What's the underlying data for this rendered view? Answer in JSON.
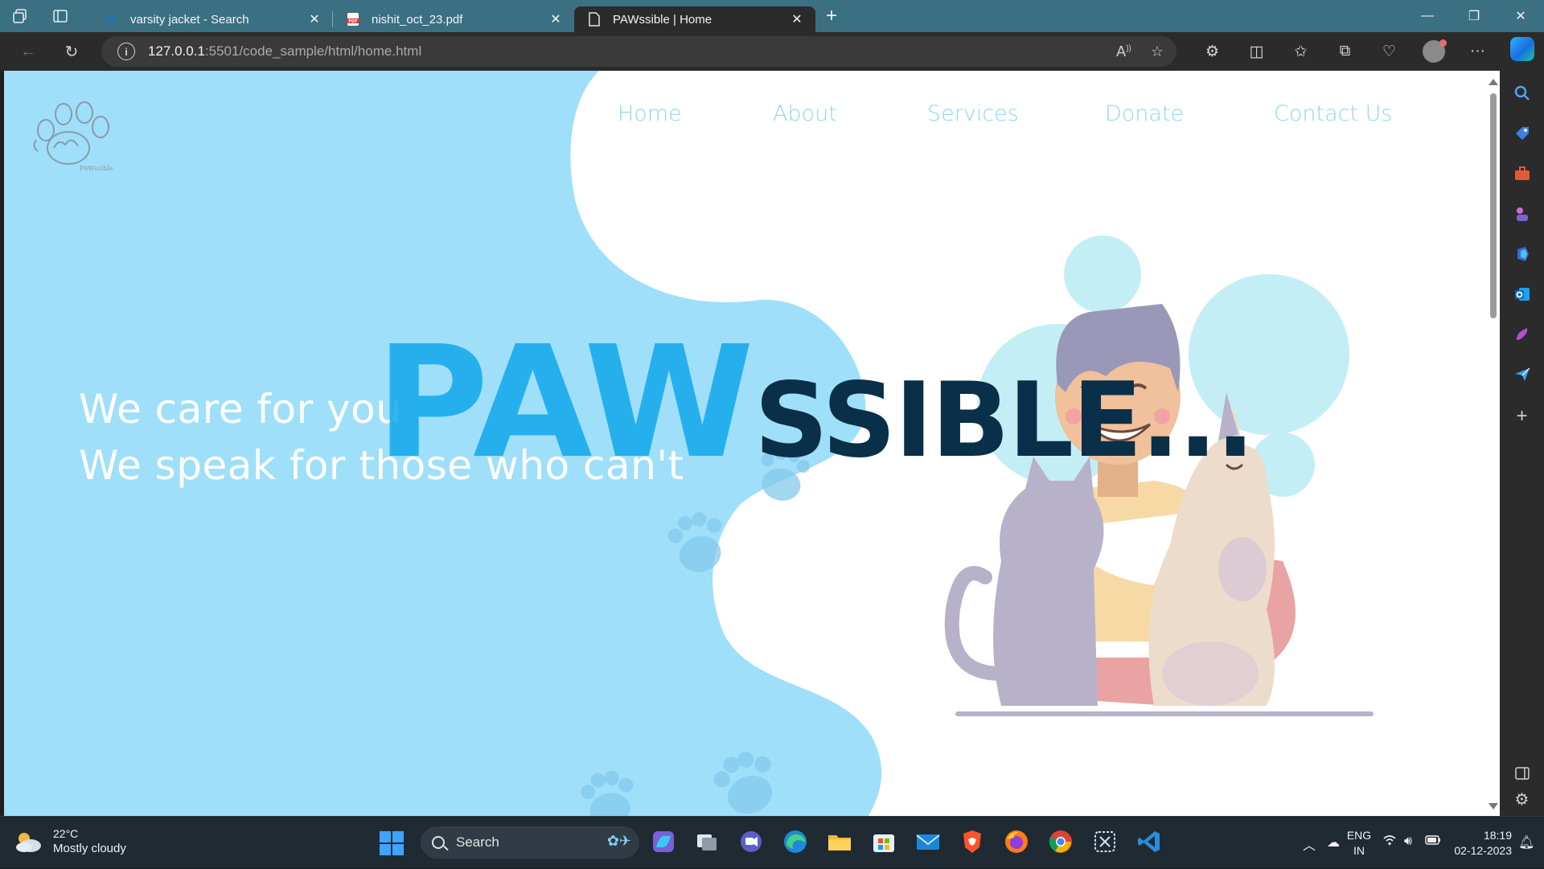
{
  "browser": {
    "tabs": [
      {
        "title": "varsity jacket - Search",
        "favicon": "search-icon",
        "active": false
      },
      {
        "title": "nishit_oct_23.pdf",
        "favicon": "pdf-icon",
        "active": false
      },
      {
        "title": "PAWssible | Home",
        "favicon": "page-icon",
        "active": true
      }
    ],
    "url_host": "127.0.0.1",
    "url_path": ":5501/code_sample/html/home.html"
  },
  "page": {
    "nav": [
      "Home",
      "About",
      "Services",
      "Donate",
      "Contact Us"
    ],
    "tagline_1": "We care for you",
    "tagline_2": "We speak for those who can't",
    "brand_paw": "PAW",
    "brand_ssible": "SSIBLE...",
    "logo_text": "PAWssible"
  },
  "taskbar": {
    "weather_temp": "22°C",
    "weather_cond": "Mostly cloudy",
    "search_label": "Search",
    "lang_1": "ENG",
    "lang_2": "IN",
    "time": "18:19",
    "date": "02-12-2023"
  },
  "colors": {
    "page_blue": "#9fdff9",
    "nav_link": "#8fd6ef",
    "brand_paw": "#10a8ec",
    "brand_ssible": "#0a2f48",
    "tab_strip": "#3b6f82"
  }
}
